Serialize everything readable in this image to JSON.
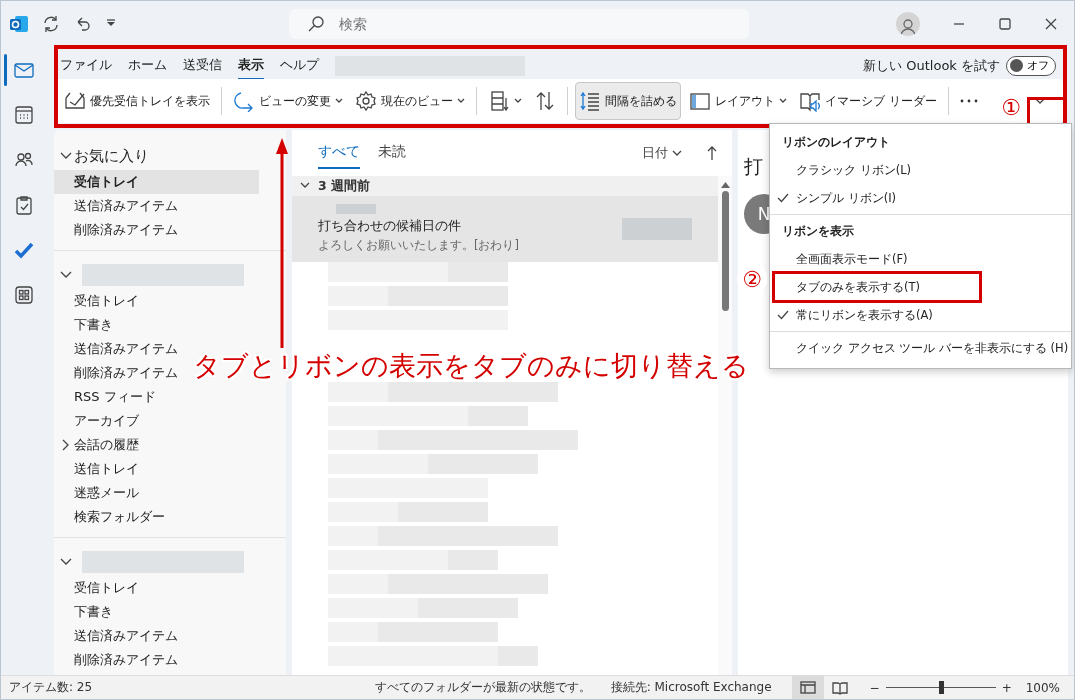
{
  "title_bar": {
    "search": {
      "placeholder": "検索"
    }
  },
  "ribbon": {
    "tabs": [
      {
        "label": "ファイル",
        "selected": false
      },
      {
        "label": "ホーム",
        "selected": false
      },
      {
        "label": "送受信",
        "selected": false
      },
      {
        "label": "表示",
        "selected": true
      },
      {
        "label": "ヘルプ",
        "selected": false
      }
    ],
    "try_new": {
      "label": "新しい Outlook を試す",
      "toggle": {
        "label": "オフ",
        "on": false
      }
    },
    "command_groups": [
      [
        {
          "label": "優先受信トレイを表示",
          "dropdown": false,
          "pressed": false
        }
      ],
      [
        {
          "label": "ビューの変更",
          "dropdown": true,
          "pressed": false
        },
        {
          "label": "現在のビュー",
          "dropdown": true,
          "pressed": false
        }
      ],
      [
        {
          "dropdown": true,
          "pressed": false
        },
        {
          "dropdown": false,
          "pressed": false
        }
      ],
      [
        {
          "label": "間隔を詰める",
          "dropdown": false,
          "pressed": true
        },
        {
          "label": "レイアウト",
          "dropdown": true,
          "pressed": false
        },
        {
          "label": "イマーシブ リーダー",
          "dropdown": false,
          "pressed": false
        }
      ],
      [
        {
          "dropdown": false,
          "pressed": false
        }
      ]
    ]
  },
  "nav_rail": [
    {
      "selected": true
    },
    {
      "selected": false
    },
    {
      "selected": false
    },
    {
      "selected": false
    },
    {
      "selected": false
    },
    {
      "selected": false
    }
  ],
  "folder_pane": {
    "groups": [
      {
        "name": "お気に入り",
        "expanded": true,
        "items": [
          {
            "label": "受信トレイ",
            "selected": true,
            "kind": "folder"
          },
          {
            "label": "送信済みアイテム",
            "selected": false,
            "kind": "folder"
          },
          {
            "label": "削除済みアイテム",
            "selected": false,
            "kind": "folder"
          }
        ]
      },
      {
        "expanded": true,
        "items": [
          {
            "label": "受信トレイ",
            "selected": false,
            "kind": "folder"
          },
          {
            "label": "下書き",
            "selected": false,
            "kind": "folder"
          },
          {
            "label": "送信済みアイテム",
            "selected": false,
            "kind": "folder"
          },
          {
            "label": "削除済みアイテム",
            "selected": false,
            "kind": "folder"
          },
          {
            "label": "RSS フィード",
            "selected": false,
            "kind": "folder"
          },
          {
            "label": "アーカイブ",
            "selected": false,
            "kind": "folder"
          },
          {
            "label": "会話の履歴",
            "selected": false,
            "kind": "parent",
            "expanded": false
          },
          {
            "label": "送信トレイ",
            "selected": false,
            "kind": "folder"
          },
          {
            "label": "迷惑メール",
            "selected": false,
            "kind": "folder"
          },
          {
            "label": "検索フォルダー",
            "selected": false,
            "kind": "folder"
          }
        ]
      },
      {
        "expanded": true,
        "items": [
          {
            "label": "受信トレイ",
            "selected": false,
            "kind": "folder"
          },
          {
            "label": "下書き",
            "selected": false,
            "kind": "folder"
          },
          {
            "label": "送信済みアイテム",
            "selected": false,
            "kind": "folder"
          },
          {
            "label": "削除済みアイテム",
            "selected": false,
            "kind": "folder"
          }
        ]
      }
    ]
  },
  "message_list": {
    "filters": [
      {
        "label": "すべて",
        "selected": true
      },
      {
        "label": "未読",
        "selected": false
      }
    ],
    "sort": {
      "label": "日付"
    },
    "groups": [
      {
        "label": "3 週間前",
        "expanded": true,
        "messages": [
          {
            "subject": "打ち合わせの候補日の件",
            "preview": "よろしくお願いいたします。[おわり]",
            "selected": true
          }
        ]
      }
    ]
  },
  "reading_pane": {
    "title": "打",
    "avatar_initial": "N"
  },
  "ribbon_menu": {
    "sections": [
      {
        "header": "リボンのレイアウト",
        "items": [
          {
            "label": "クラシック リボン(L)",
            "checked": false,
            "marked": false
          },
          {
            "label": "シンプル リボン(I)",
            "checked": true,
            "marked": false
          }
        ]
      },
      {
        "header": "リボンを表示",
        "items": [
          {
            "label": "全画面表示モード(F)",
            "checked": false,
            "marked": false
          },
          {
            "label": "タブのみを表示する(T)",
            "checked": false,
            "marked": true
          },
          {
            "label": "常にリボンを表示する(A)",
            "checked": true,
            "marked": false
          }
        ]
      },
      {
        "items": [
          {
            "label": "クイック アクセス ツール バーを非表示にする (H)",
            "checked": false,
            "marked": false
          }
        ]
      }
    ]
  },
  "annotations": {
    "caption": "タブとリボンの表示をタブのみに切り替える",
    "markers": [
      "①",
      "②"
    ]
  },
  "status_bar": {
    "items_count": "アイテム数: 25",
    "sync": "すべてのフォルダーが最新の状態です。",
    "connection": "接続先: Microsoft Exchange",
    "views": [
      {
        "selected": true
      },
      {
        "selected": false
      }
    ],
    "zoom": {
      "minus": "−",
      "plus": "+",
      "level": 0.5,
      "label": "100%"
    }
  }
}
